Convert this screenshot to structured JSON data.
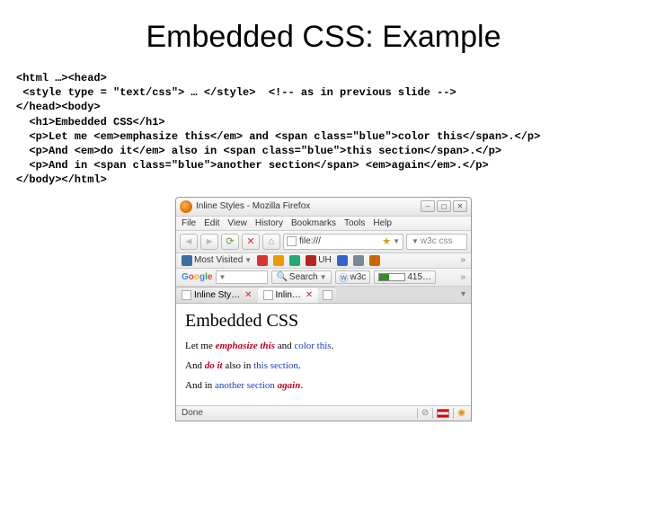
{
  "title": "Embedded CSS: Example",
  "code": {
    "l1": "<html …><head>",
    "l2": " <style type = \"text/css\"> … </style>  <!-- as in previous slide -->",
    "l3": "</head><body>",
    "l4": "  <h1>Embedded CSS</h1>",
    "l5": "  <p>Let me <em>emphasize this</em> and <span class=\"blue\">color this</span>.</p>",
    "l6": "  <p>And <em>do it</em> also in <span class=\"blue\">this section</span>.</p>",
    "l7": "  <p>And in <span class=\"blue\">another section</span> <em>again</em>.</p>",
    "l8": "</body></html>"
  },
  "browser": {
    "title": "Inline Styles - Mozilla Firefox",
    "menu": {
      "file": "File",
      "edit": "Edit",
      "view": "View",
      "history": "History",
      "bookmarks": "Bookmarks",
      "tools": "Tools",
      "help": "Help"
    },
    "url": "file:///",
    "search_placeholder": "w3c css",
    "bookmarks": {
      "most": "Most Visited",
      "uh": "UH"
    },
    "google": {
      "search": "Search",
      "w3c": "w3c",
      "pr": "415…"
    },
    "tabs": {
      "t1": "Inline Sty…",
      "t2": "Inlin…"
    },
    "content": {
      "h1": "Embedded CSS",
      "p1a": "Let me ",
      "p1em": "emphasize this",
      "p1b": " and ",
      "p1blue": "color this",
      "p1c": ".",
      "p2a": "And ",
      "p2em": "do it",
      "p2b": " also in ",
      "p2blue": "this section",
      "p2c": ".",
      "p3a": "And in ",
      "p3blue": "another section",
      "p3b": " ",
      "p3em": "again",
      "p3c": "."
    },
    "status": "Done"
  }
}
